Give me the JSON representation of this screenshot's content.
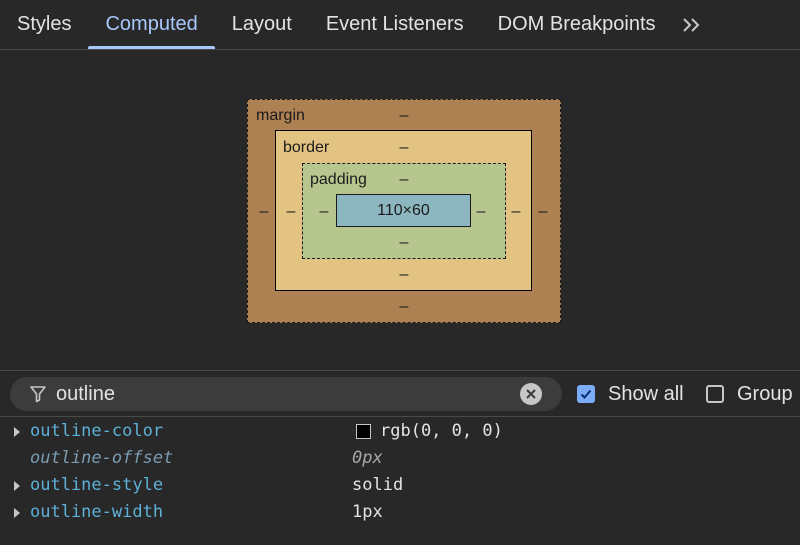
{
  "tabs": [
    {
      "label": "Styles"
    },
    {
      "label": "Computed"
    },
    {
      "label": "Layout"
    },
    {
      "label": "Event Listeners"
    },
    {
      "label": "DOM Breakpoints"
    }
  ],
  "active_tab": "Computed",
  "overflow_icon": "double-chevron-right-icon",
  "box_model": {
    "margin": {
      "label": "margin",
      "top": "–",
      "right": "–",
      "bottom": "–",
      "left": "–"
    },
    "border": {
      "label": "border",
      "top": "–",
      "right": "–",
      "bottom": "–",
      "left": "–"
    },
    "padding": {
      "label": "padding",
      "top": "–",
      "right": "–",
      "bottom": "–",
      "left": "–"
    },
    "content": "110×60",
    "colors": {
      "margin": "#ae8152",
      "border": "#e3c381",
      "padding": "#b7c68e",
      "content": "#8cb6c0"
    }
  },
  "filter": {
    "value": "outline",
    "icon": "filter-icon",
    "clear_icon": "clear-icon"
  },
  "show_all": {
    "label": "Show all",
    "checked": true
  },
  "group": {
    "label": "Group",
    "checked": false
  },
  "properties": [
    {
      "name": "outline-color",
      "value": "rgb(0, 0, 0)",
      "inherited": false,
      "swatch": "#000000"
    },
    {
      "name": "outline-offset",
      "value": "0px",
      "inherited": true
    },
    {
      "name": "outline-style",
      "value": "solid",
      "inherited": false
    },
    {
      "name": "outline-width",
      "value": "1px",
      "inherited": false
    }
  ]
}
